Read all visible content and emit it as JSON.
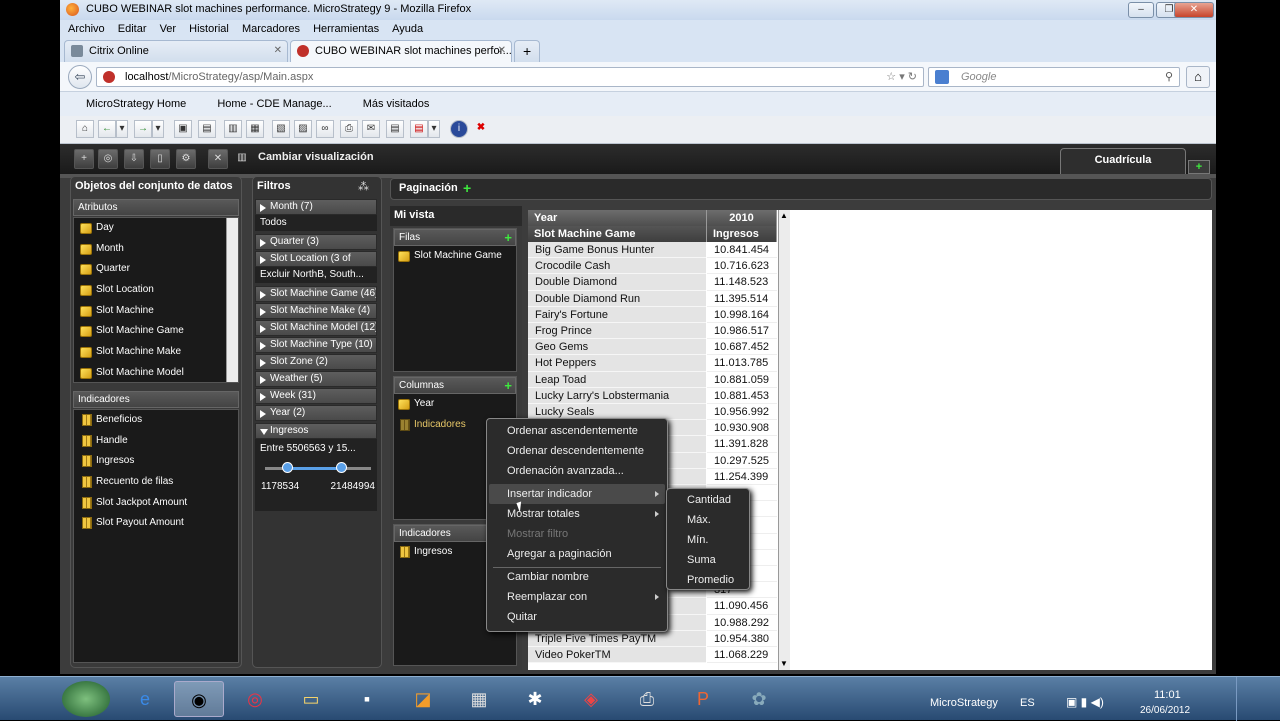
{
  "window": {
    "title": "CUBO WEBINAR slot machines performance. MicroStrategy 9 - Mozilla Firefox"
  },
  "menu": [
    "Archivo",
    "Editar",
    "Ver",
    "Historial",
    "Marcadores",
    "Herramientas",
    "Ayuda"
  ],
  "tabs": [
    {
      "label": "Citrix Online"
    },
    {
      "label": "CUBO WEBINAR slot machines perfor..."
    }
  ],
  "url": {
    "domain": "localhost",
    "path": "/MicroStrategy/asp/Main.aspx"
  },
  "search": {
    "placeholder": "Google"
  },
  "bookmarks": [
    "MicroStrategy Home",
    "Home - CDE Manage...",
    "Más visitados"
  ],
  "app": {
    "toolbar_label": "Cambiar visualización",
    "grid_tab": "Cuadrícula",
    "dataset_panel": {
      "title": "Objetos del conjunto de datos",
      "attributes_header": "Atributos",
      "attributes": [
        "Day",
        "Month",
        "Quarter",
        "Slot Location",
        "Slot Machine",
        "Slot Machine Game",
        "Slot Machine Make",
        "Slot Machine Model"
      ],
      "metrics_header": "Indicadores",
      "metrics": [
        "Beneficios",
        "Handle",
        "Ingresos",
        "Recuento de filas",
        "Slot Jackpot Amount",
        "Slot Payout Amount"
      ]
    },
    "filters": {
      "title": "Filtros",
      "items": [
        {
          "label": "Month (7)",
          "sub": "Todos"
        },
        {
          "label": "Quarter (3)"
        },
        {
          "label": "Slot Location (3 of",
          "sub": "Excluir NorthB, South..."
        },
        {
          "label": "Slot Machine Game (46)"
        },
        {
          "label": "Slot Machine Make (4)"
        },
        {
          "label": "Slot Machine Model (12)"
        },
        {
          "label": "Slot Machine Type (10)"
        },
        {
          "label": "Slot Zone (2)"
        },
        {
          "label": "Weather (5)"
        },
        {
          "label": "Week (31)"
        },
        {
          "label": "Year (2)"
        },
        {
          "label": "Ingresos",
          "sub": "Entre 5506563 y 15..."
        }
      ],
      "slider": {
        "min_label": "1178534",
        "max_label": "21484994"
      }
    },
    "pagination": "Paginación",
    "myview": {
      "title": "Mi vista",
      "rows_header": "Filas",
      "rows": [
        "Slot Machine Game"
      ],
      "cols_header": "Columnas",
      "cols": [
        "Year",
        "Indicadores"
      ],
      "metrics_header": "Indicadores",
      "metrics": [
        "Ingresos"
      ]
    },
    "grid": {
      "col1_header": "Year",
      "col2_header": "2010",
      "row_header": "Slot Machine Game",
      "metric_header": "Ingresos",
      "rows": [
        [
          "Big Game Bonus Hunter",
          "10.841.454"
        ],
        [
          "Crocodile Cash",
          "10.716.623"
        ],
        [
          "Double Diamond",
          "11.148.523"
        ],
        [
          "Double Diamond Run",
          "11.395.514"
        ],
        [
          "Fairy's Fortune",
          "10.998.164"
        ],
        [
          "Frog Prince",
          "10.986.517"
        ],
        [
          "Geo Gems",
          "10.687.452"
        ],
        [
          "Hot Peppers",
          "11.013.785"
        ],
        [
          "Leap Toad",
          "10.881.059"
        ],
        [
          "Lucky Larry's Lobstermania",
          "10.881.453"
        ],
        [
          "Lucky Seals",
          "10.956.992"
        ],
        [
          "",
          "10.930.908"
        ],
        [
          "",
          "11.391.828"
        ],
        [
          "",
          "10.297.525"
        ],
        [
          "Stars",
          "11.254.399"
        ],
        [
          "",
          "943"
        ],
        [
          "",
          "906"
        ],
        [
          "",
          "047"
        ],
        [
          "",
          "135"
        ],
        [
          "",
          "723"
        ],
        [
          "",
          "587"
        ],
        [
          "",
          "317"
        ],
        [
          "",
          "11.090.456"
        ],
        [
          "",
          "10.988.292"
        ],
        [
          "Triple Five Times PayTM",
          "10.954.380"
        ],
        [
          "Video PokerTM",
          "11.068.229"
        ]
      ]
    },
    "context_menu": [
      "Ordenar ascendentemente",
      "Ordenar descendentemente",
      "Ordenación avanzada...",
      "Insertar indicador",
      "Mostrar totales",
      "Mostrar filtro",
      "Agregar a paginación",
      "Cambiar nombre",
      "Reemplazar con",
      "Quitar"
    ],
    "submenu": [
      "Cantidad",
      "Máx.",
      "Mín.",
      "Suma",
      "Promedio"
    ]
  },
  "taskbar": {
    "app_label": "MicroStrategy",
    "lang": "ES",
    "time": "11:01",
    "date": "26/06/2012"
  }
}
